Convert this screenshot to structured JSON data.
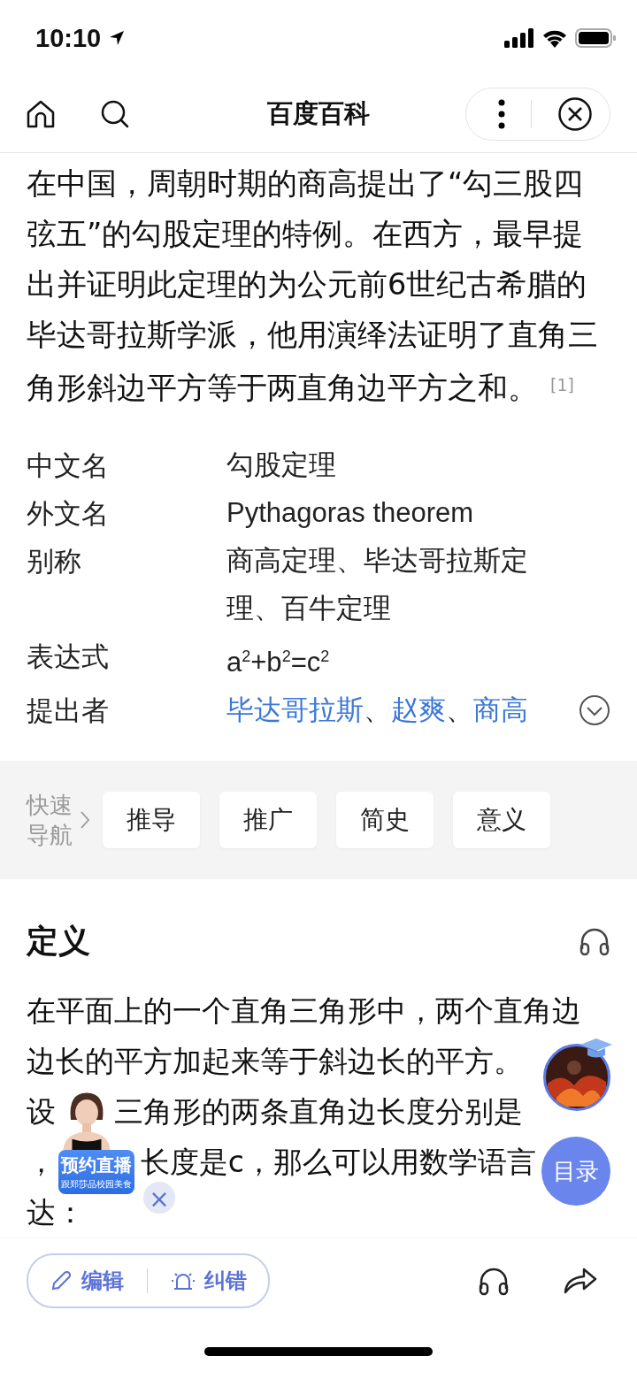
{
  "status_bar": {
    "time": "10:10"
  },
  "nav_bar": {
    "title": "百度百科"
  },
  "intro": {
    "text": "在中国，周朝时期的商高提出了“勾三股四弦五”的勾股定理的特例。在西方，最早提出并证明此定理的为公元前6世纪古希腊的毕达哥拉斯学派，他用演绎法证明了直角三角形斜边平方等于两直角边平方之和。",
    "ref": "[1]"
  },
  "info": [
    {
      "kind": "text",
      "label": "中文名",
      "value": "勾股定理"
    },
    {
      "kind": "text",
      "label": "外文名",
      "value": "Pythagoras theorem"
    },
    {
      "kind": "text",
      "label": "别称",
      "value": "商高定理、毕达哥拉斯定理、百牛定理"
    },
    {
      "kind": "text",
      "label": "表达式",
      "value": "a$^{2}$+b$^{2}$=c$^{2}$"
    },
    {
      "kind": "links",
      "label": "提出者",
      "links": [
        "毕达哥拉斯",
        "赵爽",
        "商高"
      ],
      "separator": "、",
      "expanded": false
    }
  ],
  "quick_nav": {
    "label": "快速导航",
    "items": [
      "推导",
      "推广",
      "简史",
      "意义"
    ]
  },
  "section": {
    "title": "定义",
    "lines": [
      [
        "在平面上的一个直角三角形中，两个直角边"
      ],
      [
        "边长的平方加起来等于斜边长的平方。"
      ],
      [
        "设",
        "三角形的两条直角边长度分别是"
      ],
      [
        "，",
        "长度是c，那么可以用数学语言"
      ],
      [
        "达："
      ]
    ]
  },
  "live_ad": {
    "badge": "预约直播",
    "caption": "跟郑莎品校园美食",
    "close": "×"
  },
  "toc_button": {
    "label": "目录"
  },
  "bottom_bar": {
    "edit": "编辑",
    "report": "纠错"
  }
}
